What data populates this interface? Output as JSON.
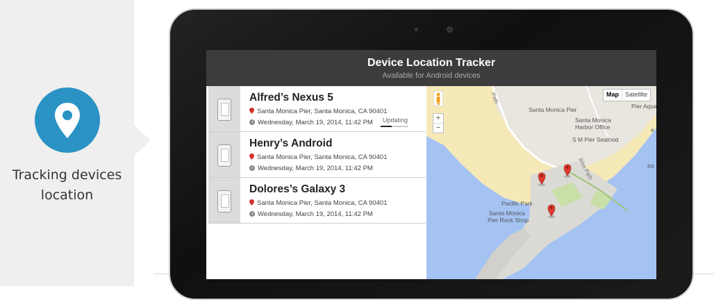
{
  "feature": {
    "icon": "location-pin-icon",
    "label_line1": "Tracking devices",
    "label_line2": "location",
    "accent": "#2b93c4"
  },
  "app": {
    "title": "Device Location Tracker",
    "subtitle": "Available for Android devices"
  },
  "devices": [
    {
      "name": "Alfred’s Nexus 5",
      "location": "Santa Monica Pier, Santa Monica, CA 90401",
      "time": "Wednesday, March 19, 2014, 11:42 PM",
      "status": "Updating",
      "progress": 0.4
    },
    {
      "name": "Henry’s Android",
      "location": "Santa Monica Pier, Santa Monica, CA 90401",
      "time": "Wednesday, March 19, 2014, 11:42 PM"
    },
    {
      "name": "Dolores’s Galaxy 3",
      "location": "Santa Monica Pier, Santa Monica, CA 90401",
      "time": "Wednesday, March 19, 2014, 11:42 PM"
    }
  ],
  "map": {
    "type_buttons": {
      "map": "Map",
      "satellite": "Satellite"
    },
    "zoom_in": "+",
    "zoom_out": "−",
    "labels": {
      "pier": "Santa Monica Pier",
      "pier_aqua": "Pier Aqua",
      "harbor_1": "Santa Monica",
      "harbor_2": "Harbor Office",
      "seafood": "S M Pier Seafood",
      "bike_path": "Bike Path",
      "path": "Path",
      "pacific_park": "Pacific Park",
      "rock_shop_1": "Santa Monica",
      "rock_shop_2": "Pier Rock Shop",
      "edge_1": "e",
      "edge_2": "Int"
    },
    "colors": {
      "water": "#a4c3f3",
      "sand": "#f6e9b8",
      "land": "#e9e6df",
      "park": "#c9dfa8",
      "pin": "#e03a2f"
    }
  }
}
